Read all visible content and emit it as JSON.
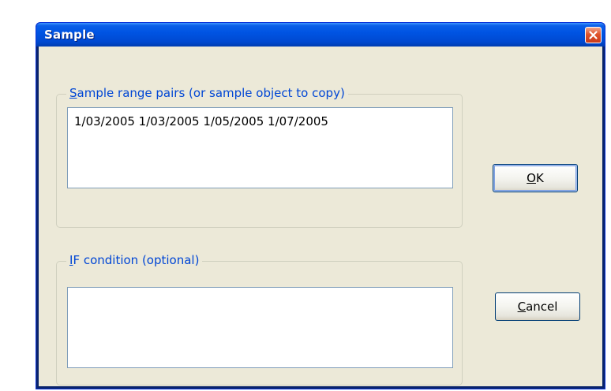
{
  "dialog": {
    "title": "Sample",
    "close_icon": "close-icon"
  },
  "sample_group": {
    "label_accel": "S",
    "label_rest": "ample range pairs (or sample object to copy)",
    "value": "1/03/2005 1/03/2005 1/05/2005 1/07/2005"
  },
  "if_group": {
    "label_accel": "I",
    "label_rest": "F condition (optional)",
    "value": ""
  },
  "buttons": {
    "ok_accel": "O",
    "ok_rest": "K",
    "cancel_accel": "C",
    "cancel_rest": "ancel"
  },
  "colors": {
    "titlebar": "#0054e3",
    "client_bg": "#ece9d8",
    "group_label": "#0046d5",
    "close_button": "#e0542b"
  }
}
